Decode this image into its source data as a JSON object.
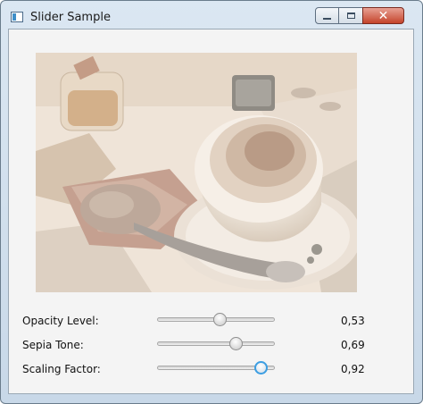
{
  "window": {
    "title": "Slider Sample"
  },
  "controls": {
    "close_glyph": "✕"
  },
  "image": {
    "description_icon": "photo-icon"
  },
  "sliders": [
    {
      "label": "Opacity Level:",
      "value_text": "0,53",
      "fraction": 0.53,
      "focused": false
    },
    {
      "label": "Sepia Tone:",
      "value_text": "0,69",
      "fraction": 0.69,
      "focused": false
    },
    {
      "label": "Scaling Factor:",
      "value_text": "0,92",
      "fraction": 0.92,
      "focused": true
    }
  ],
  "colors": {
    "focus_ring": "#3c9ee2"
  }
}
